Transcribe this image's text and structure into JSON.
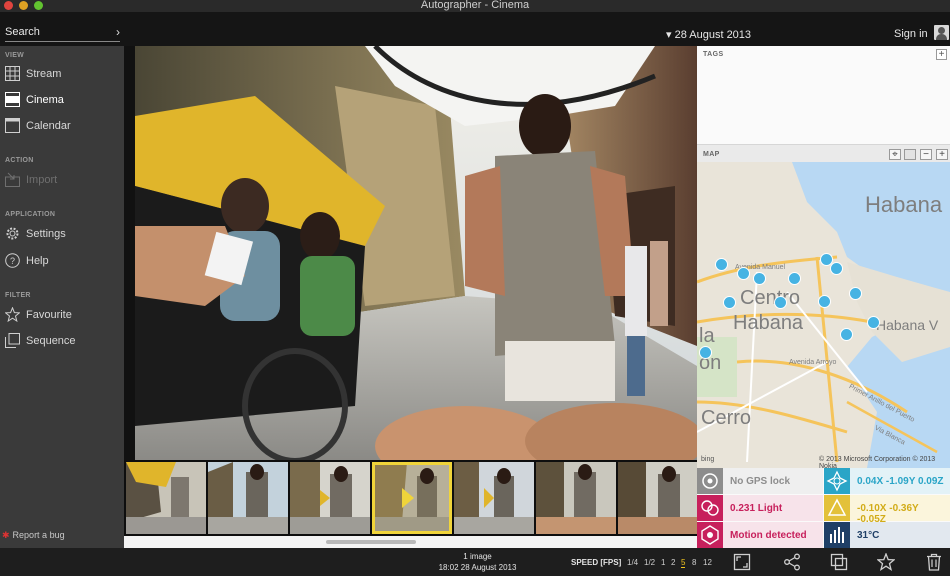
{
  "window": {
    "title": "Autographer - Cinema"
  },
  "header": {
    "search_placeholder": "Search",
    "date": "▾ 28 August 2013",
    "sign_in": "Sign in"
  },
  "sidebar": {
    "sections": {
      "view": "VIEW",
      "action": "ACTION",
      "application": "APPLICATION",
      "filter": "FILTER"
    },
    "items": [
      {
        "label": "Stream",
        "icon": "grid-icon"
      },
      {
        "label": "Cinema",
        "icon": "filmstrip-icon",
        "active": true
      },
      {
        "label": "Calendar",
        "icon": "calendar-icon"
      },
      {
        "label": "Import",
        "icon": "import-icon",
        "disabled": true
      },
      {
        "label": "Settings",
        "icon": "gear-icon"
      },
      {
        "label": "Help",
        "icon": "help-icon"
      },
      {
        "label": "Favourite",
        "icon": "star-icon"
      },
      {
        "label": "Sequence",
        "icon": "sequence-icon"
      }
    ],
    "report_bug": "Report a bug"
  },
  "right_panel": {
    "tags_title": "TAGS",
    "map_title": "MAP",
    "map": {
      "labels": [
        "Habana",
        "Centro",
        "Habana",
        "Habana V",
        "Cerro",
        "Avenida Manuel",
        "Avenida Arroyo",
        "Primer Anillo del Puerto",
        "Via Blanca",
        "la",
        "on"
      ],
      "copyright": "© 2013 Microsoft Corporation © 2013 Nokia",
      "bing": "bing"
    },
    "sensors": [
      {
        "label": "No GPS lock",
        "color": "#8d8d8d",
        "icon": "gps-icon"
      },
      {
        "label": "0.04X  -1.09Y  0.09Z",
        "color": "#2aa5c7",
        "icon": "compass-icon"
      },
      {
        "label": "0.231 Light",
        "color": "#c7205c",
        "icon": "light-icon"
      },
      {
        "label": "-0.10X  -0.36Y  -0.05Z",
        "color": "#e3c13a",
        "icon": "accelerometer-icon"
      },
      {
        "label": "Motion detected",
        "color": "#c7205c",
        "icon": "motion-icon"
      },
      {
        "label": "31°C",
        "color": "#1f3f66",
        "icon": "temperature-icon"
      }
    ]
  },
  "bottom_bar": {
    "image_count": "1 image",
    "timestamp": "18:02 28 August 2013",
    "speed_label": "SPEED [FPS]",
    "speeds": [
      "1/4",
      "1/2",
      "1",
      "2",
      "5",
      "8",
      "12"
    ],
    "speed_selected": "5"
  },
  "colors": {
    "accent": "#f0d43a",
    "sidebar": "#3a3a3a"
  }
}
